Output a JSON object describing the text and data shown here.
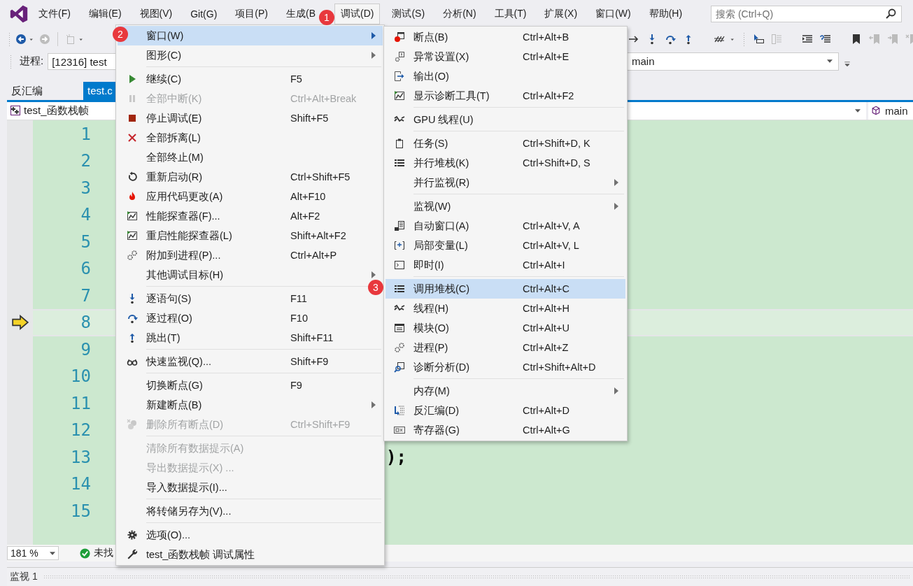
{
  "menubar": {
    "items": [
      {
        "label": "文件(F)",
        "selected": false
      },
      {
        "label": "编辑(E)",
        "selected": false
      },
      {
        "label": "视图(V)",
        "selected": false
      },
      {
        "label": "Git(G)",
        "selected": false
      },
      {
        "label": "项目(P)",
        "selected": false
      },
      {
        "label": "生成(B",
        "selected": false
      },
      {
        "label": "调试(D)",
        "selected": true
      },
      {
        "label": "测试(S)",
        "selected": false
      },
      {
        "label": "分析(N)",
        "selected": false
      },
      {
        "label": "工具(T)",
        "selected": false
      },
      {
        "label": "扩展(X)",
        "selected": false
      },
      {
        "label": "窗口(W)",
        "selected": false
      },
      {
        "label": "帮助(H)",
        "selected": false
      }
    ]
  },
  "search": {
    "placeholder": "搜索 (Ctrl+Q)"
  },
  "annotation_badges": [
    "1",
    "2",
    "3"
  ],
  "process_bar": {
    "label": "进程:",
    "process": "[12316] test",
    "stack_frame": "main"
  },
  "doc_tabs": [
    {
      "label": "反汇编",
      "selected": false
    },
    {
      "label": "test.c",
      "selected": true
    }
  ],
  "nav_bar": {
    "scope": "test_函数栈帧",
    "member": "main"
  },
  "editor": {
    "lines": [
      {
        "number": "1",
        "current": false
      },
      {
        "number": "2",
        "current": false
      },
      {
        "number": "3",
        "current": false
      },
      {
        "number": "4",
        "current": false
      },
      {
        "number": "5",
        "current": false
      },
      {
        "number": "6",
        "current": false
      },
      {
        "number": "7",
        "current": false
      },
      {
        "number": "8",
        "current": true
      },
      {
        "number": "9",
        "current": false
      },
      {
        "number": "10",
        "current": false
      },
      {
        "number": "11",
        "current": false
      },
      {
        "number": "12",
        "current": false
      },
      {
        "number": "13",
        "current": false,
        "code": ");"
      },
      {
        "number": "14",
        "current": false
      },
      {
        "number": "15",
        "current": false
      }
    ]
  },
  "status_bar": {
    "zoom": "181 %",
    "message": "未找"
  },
  "bottom_panel": {
    "tab": "监视 1"
  },
  "debug_menu": {
    "groups": [
      {
        "items": [
          {
            "label": "窗口(W)",
            "selected": true,
            "disabled": false,
            "submenu": true
          },
          {
            "label": "图形(C)",
            "selected": false,
            "disabled": false,
            "submenu": true
          }
        ]
      },
      {
        "items": [
          {
            "label": "继续(C)",
            "shortcut": "F5",
            "selected": false,
            "disabled": false,
            "submenu": false
          },
          {
            "label": "全部中断(K)",
            "shortcut": "Ctrl+Alt+Break",
            "selected": false,
            "disabled": true,
            "submenu": false
          },
          {
            "label": "停止调试(E)",
            "shortcut": "Shift+F5",
            "selected": false,
            "disabled": false,
            "submenu": false
          },
          {
            "label": "全部拆离(L)",
            "selected": false,
            "disabled": false,
            "submenu": false
          },
          {
            "label": "全部终止(M)",
            "selected": false,
            "disabled": false,
            "submenu": false
          },
          {
            "label": "重新启动(R)",
            "shortcut": "Ctrl+Shift+F5",
            "selected": false,
            "disabled": false,
            "submenu": false
          },
          {
            "label": "应用代码更改(A)",
            "shortcut": "Alt+F10",
            "selected": false,
            "disabled": false,
            "submenu": false
          },
          {
            "label": "性能探查器(F)...",
            "shortcut": "Alt+F2",
            "selected": false,
            "disabled": false,
            "submenu": false
          },
          {
            "label": "重启性能探查器(L)",
            "shortcut": "Shift+Alt+F2",
            "selected": false,
            "disabled": false,
            "submenu": false
          },
          {
            "label": "附加到进程(P)...",
            "shortcut": "Ctrl+Alt+P",
            "selected": false,
            "disabled": false,
            "submenu": false
          },
          {
            "label": "其他调试目标(H)",
            "selected": false,
            "disabled": false,
            "submenu": true
          }
        ]
      },
      {
        "items": [
          {
            "label": "逐语句(S)",
            "shortcut": "F11",
            "selected": false,
            "disabled": false,
            "submenu": false
          },
          {
            "label": "逐过程(O)",
            "shortcut": "F10",
            "selected": false,
            "disabled": false,
            "submenu": false
          },
          {
            "label": "跳出(T)",
            "shortcut": "Shift+F11",
            "selected": false,
            "disabled": false,
            "submenu": false
          }
        ]
      },
      {
        "items": [
          {
            "label": "快速监视(Q)...",
            "shortcut": "Shift+F9",
            "selected": false,
            "disabled": false,
            "submenu": false
          }
        ]
      },
      {
        "items": [
          {
            "label": "切换断点(G)",
            "shortcut": "F9",
            "selected": false,
            "disabled": false,
            "submenu": false
          },
          {
            "label": "新建断点(B)",
            "selected": false,
            "disabled": false,
            "submenu": true
          },
          {
            "label": "删除所有断点(D)",
            "shortcut": "Ctrl+Shift+F9",
            "selected": false,
            "disabled": true,
            "submenu": false
          }
        ]
      },
      {
        "items": [
          {
            "label": "清除所有数据提示(A)",
            "selected": false,
            "disabled": true,
            "submenu": false
          },
          {
            "label": "导出数据提示(X) ...",
            "selected": false,
            "disabled": true,
            "submenu": false
          },
          {
            "label": "导入数据提示(I)...",
            "selected": false,
            "disabled": false,
            "submenu": false
          }
        ]
      },
      {
        "items": [
          {
            "label": "将转储另存为(V)...",
            "selected": false,
            "disabled": false,
            "submenu": false
          }
        ]
      },
      {
        "items": [
          {
            "label": "选项(O)...",
            "selected": false,
            "disabled": false,
            "submenu": false
          },
          {
            "label": "test_函数栈帧 调试属性",
            "selected": false,
            "disabled": false,
            "submenu": false
          }
        ]
      }
    ]
  },
  "window_submenu": {
    "groups": [
      {
        "items": [
          {
            "label": "断点(B)",
            "shortcut": "Ctrl+Alt+B",
            "selected": false,
            "submenu": false
          },
          {
            "label": "异常设置(X)",
            "shortcut": "Ctrl+Alt+E",
            "selected": false,
            "submenu": false
          },
          {
            "label": "输出(O)",
            "selected": false,
            "submenu": false
          },
          {
            "label": "显示诊断工具(T)",
            "shortcut": "Ctrl+Alt+F2",
            "selected": false,
            "submenu": false
          }
        ]
      },
      {
        "items": [
          {
            "label": "GPU 线程(U)",
            "selected": false,
            "submenu": false
          }
        ]
      },
      {
        "items": [
          {
            "label": "任务(S)",
            "shortcut": "Ctrl+Shift+D, K",
            "selected": false,
            "submenu": false
          },
          {
            "label": "并行堆栈(K)",
            "shortcut": "Ctrl+Shift+D, S",
            "selected": false,
            "submenu": false
          },
          {
            "label": "并行监视(R)",
            "selected": false,
            "submenu": true
          }
        ]
      },
      {
        "items": [
          {
            "label": "监视(W)",
            "selected": false,
            "submenu": true
          },
          {
            "label": "自动窗口(A)",
            "shortcut": "Ctrl+Alt+V, A",
            "selected": false,
            "submenu": false
          },
          {
            "label": "局部变量(L)",
            "shortcut": "Ctrl+Alt+V, L",
            "selected": false,
            "submenu": false
          },
          {
            "label": "即时(I)",
            "shortcut": "Ctrl+Alt+I",
            "selected": false,
            "submenu": false
          }
        ]
      },
      {
        "items": [
          {
            "label": "调用堆栈(C)",
            "shortcut": "Ctrl+Alt+C",
            "selected": true,
            "submenu": false
          },
          {
            "label": "线程(H)",
            "shortcut": "Ctrl+Alt+H",
            "selected": false,
            "submenu": false
          },
          {
            "label": "模块(O)",
            "shortcut": "Ctrl+Alt+U",
            "selected": false,
            "submenu": false
          },
          {
            "label": "进程(P)",
            "shortcut": "Ctrl+Alt+Z",
            "selected": false,
            "submenu": false
          },
          {
            "label": "诊断分析(D)",
            "shortcut": "Ctrl+Shift+Alt+D",
            "selected": false,
            "submenu": false
          }
        ]
      },
      {
        "items": [
          {
            "label": "内存(M)",
            "selected": false,
            "submenu": true
          },
          {
            "label": "反汇编(D)",
            "shortcut": "Ctrl+Alt+D",
            "selected": false,
            "submenu": false
          },
          {
            "label": "寄存器(G)",
            "shortcut": "Ctrl+Alt+G",
            "selected": false,
            "submenu": false
          }
        ]
      }
    ]
  }
}
